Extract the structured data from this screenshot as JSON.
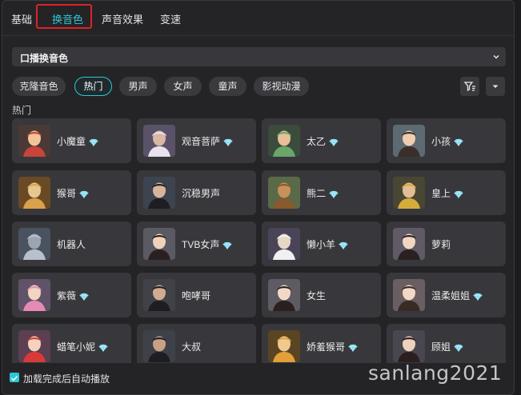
{
  "tabs": [
    {
      "label": "基础"
    },
    {
      "label": "换音色"
    },
    {
      "label": "声音效果"
    },
    {
      "label": "变速"
    }
  ],
  "dropdown": {
    "value": "口播换音色"
  },
  "chips": [
    {
      "label": "克隆音色"
    },
    {
      "label": "热门"
    },
    {
      "label": "男声"
    },
    {
      "label": "女声"
    },
    {
      "label": "童声"
    },
    {
      "label": "影视动漫"
    }
  ],
  "section_title": "热门",
  "voices": [
    {
      "name": "小魔童",
      "premium": true,
      "avatar": "nezha"
    },
    {
      "name": "观音菩萨",
      "premium": true,
      "avatar": "guanyin"
    },
    {
      "name": "太乙",
      "premium": true,
      "avatar": "taiyi"
    },
    {
      "name": "小孩",
      "premium": true,
      "avatar": "child"
    },
    {
      "name": "猴哥",
      "premium": true,
      "avatar": "monkey"
    },
    {
      "name": "沉稳男声",
      "premium": false,
      "avatar": "man"
    },
    {
      "name": "熊二",
      "premium": true,
      "avatar": "bear"
    },
    {
      "name": "皇上",
      "premium": true,
      "avatar": "emperor"
    },
    {
      "name": "机器人",
      "premium": false,
      "avatar": "robot"
    },
    {
      "name": "TVB女声",
      "premium": true,
      "avatar": "woman"
    },
    {
      "name": "懒小羊",
      "premium": true,
      "avatar": "sheep"
    },
    {
      "name": "萝莉",
      "premium": false,
      "avatar": "girl"
    },
    {
      "name": "紫薇",
      "premium": true,
      "avatar": "ziwei"
    },
    {
      "name": "咆哮哥",
      "premium": false,
      "avatar": "shouter"
    },
    {
      "name": "女生",
      "premium": false,
      "avatar": "woman2"
    },
    {
      "name": "温柔姐姐",
      "premium": true,
      "avatar": "sister"
    },
    {
      "name": "蜡笔小妮",
      "premium": true,
      "avatar": "doll"
    },
    {
      "name": "大叔",
      "premium": false,
      "avatar": "uncle"
    },
    {
      "name": "娇羞猴哥",
      "premium": true,
      "avatar": "monkey2"
    },
    {
      "name": "顾姐",
      "premium": true,
      "avatar": "lady"
    }
  ],
  "footer": {
    "autoplay_label": "加载完成后自动播放",
    "autoplay_checked": true
  },
  "watermark": "sanlang2021",
  "colors": {
    "accent": "#2ec7d4",
    "highlight_frame": "#e02222",
    "gem": "#7fd8f0"
  }
}
